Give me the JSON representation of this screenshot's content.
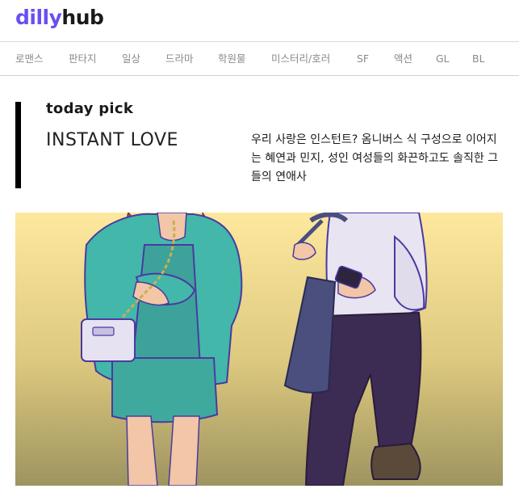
{
  "logo": {
    "part1": "dilly",
    "part2": "hub"
  },
  "nav": {
    "items": [
      "로맨스",
      "판타지",
      "일상",
      "드라마",
      "학원물",
      "미스터리/호러",
      "SF",
      "액션",
      "GL",
      "BL"
    ]
  },
  "today_pick": {
    "label": "today pick",
    "title": "INSTANT LOVE",
    "description": "우리 사랑은 인스턴트? 옴니버스 식 구성으로 이어지는 혜연과 민지, 성인 여성들의 화끈하고도 솔직한 그들의 연애사"
  },
  "colors": {
    "brand": "#6b4ef0",
    "hero_top": "#fde59a",
    "hero_bottom": "#a59a5f"
  }
}
